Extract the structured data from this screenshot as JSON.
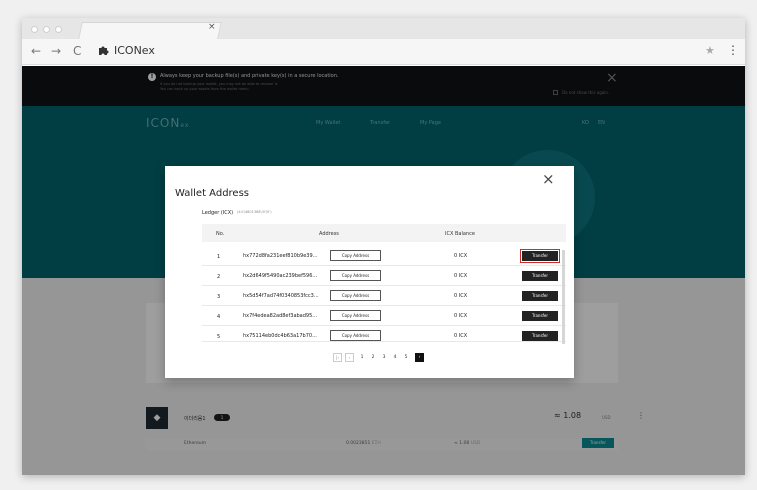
{
  "browser": {
    "site_title": "ICONex",
    "tab_close": "×",
    "back": "←",
    "forward": "→",
    "reload": "C",
    "star": "★",
    "menu": "⋮",
    "extension_icon": "puzzle-icon"
  },
  "notice": {
    "icon": "!",
    "main": "Always keep your backup file(s) and private key(s) in a secure location.",
    "sub": "If you do not backup your wallet, you may not be able to recover it.\nYou can back up your assets from the wallet menu.",
    "close": "×",
    "checkbox_label": "Do not show this again."
  },
  "header": {
    "logo": "ICON",
    "logo_suffix": "ex",
    "nav": [
      "My Wallet",
      "Transfer",
      "My Page"
    ],
    "lang": [
      "KO",
      "EN"
    ]
  },
  "background_wallet": {
    "name": "이더리움1",
    "badge": "1",
    "amount": "≈ 1.08",
    "unit": "USD",
    "token": "Ethereum",
    "balance": "0.0023851",
    "balance_unit": "ETH",
    "fiat": "≈ 1.08",
    "fiat_unit": "USD",
    "transfer": "Transfer",
    "dots": "⋮"
  },
  "modal": {
    "title": "Wallet Address",
    "close": "×",
    "subtitle": "Ledger (ICX)",
    "path": "(44'/4801368'/0'/0')",
    "columns": {
      "no": "No.",
      "address": "Address",
      "balance": "ICX Balance"
    },
    "rows": [
      {
        "no": "1",
        "address": "hx772d8fa231eef810b9e39...",
        "copy": "Copy Address",
        "balance": "0 ICX",
        "transfer": "Transfer"
      },
      {
        "no": "2",
        "address": "hx2d649f5490ac239bef596...",
        "copy": "Copy Address",
        "balance": "0 ICX",
        "transfer": "Transfer"
      },
      {
        "no": "3",
        "address": "hx5d54f7ad74f0340853fcc3...",
        "copy": "Copy Address",
        "balance": "0 ICX",
        "transfer": "Transfer"
      },
      {
        "no": "4",
        "address": "hx7f4edea82ad8ef3abad95...",
        "copy": "Copy Address",
        "balance": "0 ICX",
        "transfer": "Transfer"
      },
      {
        "no": "5",
        "address": "hx75114eb0dc4b63a17b70...",
        "copy": "Copy Address",
        "balance": "0 ICX",
        "transfer": "Transfer"
      }
    ],
    "pager": {
      "first": "|‹",
      "prev": "‹",
      "pages": [
        "1",
        "2",
        "3",
        "4",
        "5"
      ],
      "next": "›"
    }
  }
}
